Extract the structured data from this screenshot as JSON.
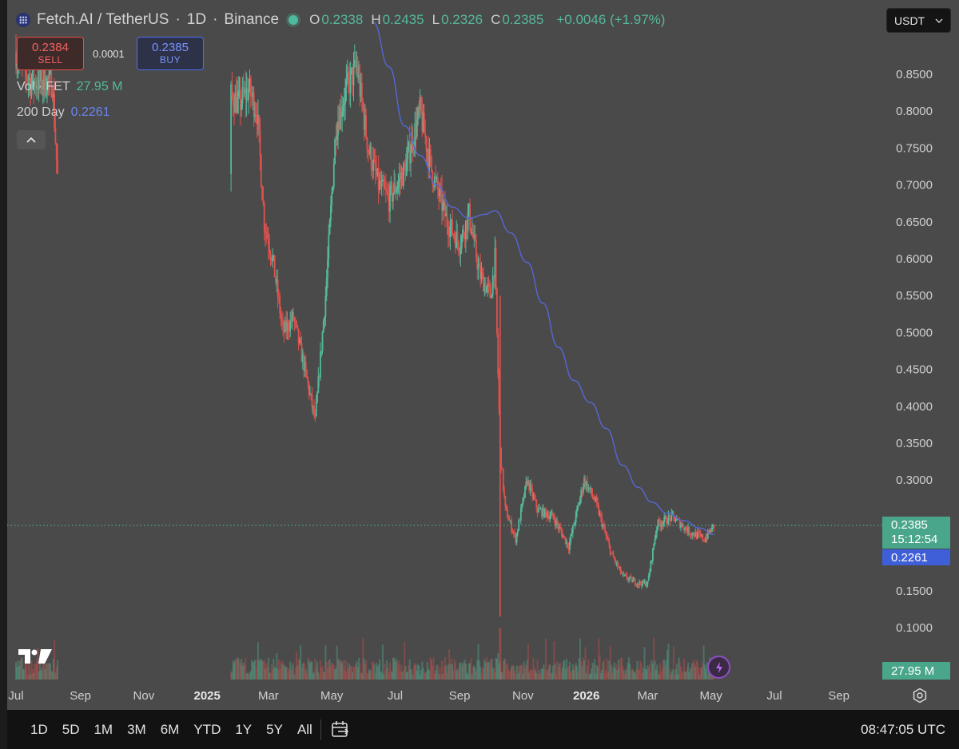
{
  "header": {
    "symbol": "Fetch.AI / TetherUS",
    "interval": "1D",
    "exchange": "Binance",
    "ohlc": [
      {
        "key": "O",
        "value": "0.2338"
      },
      {
        "key": "H",
        "value": "0.2435"
      },
      {
        "key": "L",
        "value": "0.2326"
      },
      {
        "key": "C",
        "value": "0.2385"
      }
    ],
    "change": "+0.0046 (+1.97%)"
  },
  "trade": {
    "sell_price": "0.2384",
    "sell_label": "SELL",
    "spread": "0.0001",
    "buy_price": "0.2385",
    "buy_label": "BUY"
  },
  "indicators": {
    "volume_label": "Vol · FET",
    "volume_value": "27.95 M",
    "ma_label": "200 Day",
    "ma_value": "0.2261"
  },
  "currency": "USDT",
  "price_tags": {
    "last": "0.2385",
    "countdown": "15:12:54",
    "ma": "0.2261",
    "volume": "27.95 M"
  },
  "time_ranges": [
    "1D",
    "5D",
    "1M",
    "3M",
    "6M",
    "YTD",
    "1Y",
    "5Y",
    "All"
  ],
  "clock": "08:47:05 UTC",
  "colors": {
    "background": "#4a4a4a",
    "up": "#55b99c",
    "down": "#e0514d",
    "ma": "#5468d6",
    "toolbar": "#121212"
  },
  "icons": {
    "symbol": "fetch-ai-logo-icon",
    "collapse": "chevron-up-icon",
    "currency": "chevron-down-icon",
    "brand": "tradingview-logo-icon",
    "bolt": "lightning-bolt-icon",
    "settings": "settings-gear-icon",
    "date_range": "calendar-range-icon"
  },
  "chart_data": {
    "type": "candlestick",
    "series": [
      {
        "name": "Fetch.AI / TetherUS",
        "kind": "price"
      },
      {
        "name": "200 Day",
        "kind": "moving-average"
      },
      {
        "name": "Vol · FET",
        "kind": "volume"
      }
    ],
    "y_ticks": [
      "0.8500",
      "0.8000",
      "0.7500",
      "0.7000",
      "0.6500",
      "0.6000",
      "0.5500",
      "0.5000",
      "0.4500",
      "0.4000",
      "0.3500",
      "0.3000",
      "0.1500",
      "0.1000"
    ],
    "x_ticks": [
      {
        "label": "Jul",
        "bold": false
      },
      {
        "label": "Sep",
        "bold": false
      },
      {
        "label": "Nov",
        "bold": false
      },
      {
        "label": "2025",
        "bold": true
      },
      {
        "label": "Mar",
        "bold": false
      },
      {
        "label": "May",
        "bold": false
      },
      {
        "label": "Jul",
        "bold": false
      },
      {
        "label": "Sep",
        "bold": false
      },
      {
        "label": "Nov",
        "bold": false
      },
      {
        "label": "2026",
        "bold": true
      },
      {
        "label": "Mar",
        "bold": false
      },
      {
        "label": "May",
        "bold": false
      },
      {
        "label": "Jul",
        "bold": false
      },
      {
        "label": "Sep",
        "bold": false
      }
    ],
    "ylim": [
      0.08,
      0.9
    ],
    "price_path": [
      {
        "date": "2024-07-01",
        "value": 0.88
      },
      {
        "date": "2024-07-15",
        "value": 0.84
      },
      {
        "date": "2024-08-05",
        "value": 0.84
      },
      {
        "date": "2024-08-10",
        "value": 0.71
      },
      {
        "date": "2025-01-24",
        "value": 0.82
      },
      {
        "date": "2025-02-01",
        "value": 0.81
      },
      {
        "date": "2025-02-10",
        "value": 0.83
      },
      {
        "date": "2025-02-18",
        "value": 0.8
      },
      {
        "date": "2025-02-25",
        "value": 0.65
      },
      {
        "date": "2025-03-05",
        "value": 0.6
      },
      {
        "date": "2025-03-15",
        "value": 0.5
      },
      {
        "date": "2025-03-25",
        "value": 0.52
      },
      {
        "date": "2025-04-05",
        "value": 0.45
      },
      {
        "date": "2025-04-15",
        "value": 0.38
      },
      {
        "date": "2025-04-25",
        "value": 0.55
      },
      {
        "date": "2025-05-05",
        "value": 0.78
      },
      {
        "date": "2025-05-15",
        "value": 0.83
      },
      {
        "date": "2025-05-25",
        "value": 0.86
      },
      {
        "date": "2025-06-05",
        "value": 0.75
      },
      {
        "date": "2025-06-15",
        "value": 0.7
      },
      {
        "date": "2025-06-25",
        "value": 0.68
      },
      {
        "date": "2025-07-10",
        "value": 0.72
      },
      {
        "date": "2025-07-25",
        "value": 0.8
      },
      {
        "date": "2025-08-05",
        "value": 0.72
      },
      {
        "date": "2025-08-20",
        "value": 0.65
      },
      {
        "date": "2025-09-01",
        "value": 0.62
      },
      {
        "date": "2025-09-10",
        "value": 0.66
      },
      {
        "date": "2025-09-20",
        "value": 0.58
      },
      {
        "date": "2025-10-01",
        "value": 0.55
      },
      {
        "date": "2025-10-05",
        "value": 0.6
      },
      {
        "date": "2025-10-10",
        "value": 0.34
      },
      {
        "date": "2025-10-15",
        "value": 0.26
      },
      {
        "date": "2025-10-25",
        "value": 0.22
      },
      {
        "date": "2025-11-05",
        "value": 0.3
      },
      {
        "date": "2025-11-15",
        "value": 0.26
      },
      {
        "date": "2025-11-30",
        "value": 0.25
      },
      {
        "date": "2025-12-15",
        "value": 0.21
      },
      {
        "date": "2025-12-30",
        "value": 0.3
      },
      {
        "date": "2026-01-10",
        "value": 0.27
      },
      {
        "date": "2026-01-25",
        "value": 0.2
      },
      {
        "date": "2026-02-05",
        "value": 0.17
      },
      {
        "date": "2026-02-20",
        "value": 0.16
      },
      {
        "date": "2026-03-01",
        "value": 0.16
      },
      {
        "date": "2026-03-10",
        "value": 0.24
      },
      {
        "date": "2026-03-25",
        "value": 0.25
      },
      {
        "date": "2026-04-10",
        "value": 0.23
      },
      {
        "date": "2026-04-25",
        "value": 0.22
      },
      {
        "date": "2026-05-04",
        "value": 0.2385
      }
    ],
    "ma_path": [
      {
        "date": "2025-06-10",
        "value": 0.92
      },
      {
        "date": "2025-06-25",
        "value": 0.86
      },
      {
        "date": "2025-07-10",
        "value": 0.78
      },
      {
        "date": "2025-07-25",
        "value": 0.74
      },
      {
        "date": "2025-08-10",
        "value": 0.7
      },
      {
        "date": "2025-08-25",
        "value": 0.67
      },
      {
        "date": "2025-09-10",
        "value": 0.655
      },
      {
        "date": "2025-09-25",
        "value": 0.66
      },
      {
        "date": "2025-10-05",
        "value": 0.665
      },
      {
        "date": "2025-10-20",
        "value": 0.635
      },
      {
        "date": "2025-11-05",
        "value": 0.595
      },
      {
        "date": "2025-11-20",
        "value": 0.54
      },
      {
        "date": "2025-12-05",
        "value": 0.48
      },
      {
        "date": "2025-12-20",
        "value": 0.435
      },
      {
        "date": "2026-01-05",
        "value": 0.405
      },
      {
        "date": "2026-01-20",
        "value": 0.37
      },
      {
        "date": "2026-02-05",
        "value": 0.32
      },
      {
        "date": "2026-02-20",
        "value": 0.29
      },
      {
        "date": "2026-03-05",
        "value": 0.27
      },
      {
        "date": "2026-03-20",
        "value": 0.255
      },
      {
        "date": "2026-04-05",
        "value": 0.245
      },
      {
        "date": "2026-04-20",
        "value": 0.235
      },
      {
        "date": "2026-05-04",
        "value": 0.2261
      }
    ],
    "last_price": 0.2385,
    "last_date": "2026-05-04"
  }
}
